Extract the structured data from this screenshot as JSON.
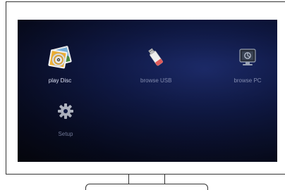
{
  "menu": {
    "items": [
      {
        "label": "play Disc",
        "icon": "photo-disc-icon",
        "selected": true
      },
      {
        "label": "browse USB",
        "icon": "usb-drive-icon",
        "selected": false
      },
      {
        "label": "browse PC",
        "icon": "pc-icon",
        "selected": false
      },
      {
        "label": "Setup",
        "icon": "gear-icon",
        "selected": false
      }
    ]
  },
  "colors": {
    "screen_bg": "#0a0f2a",
    "label_default": "#8a93b8",
    "label_selected": "#e8ecff"
  }
}
